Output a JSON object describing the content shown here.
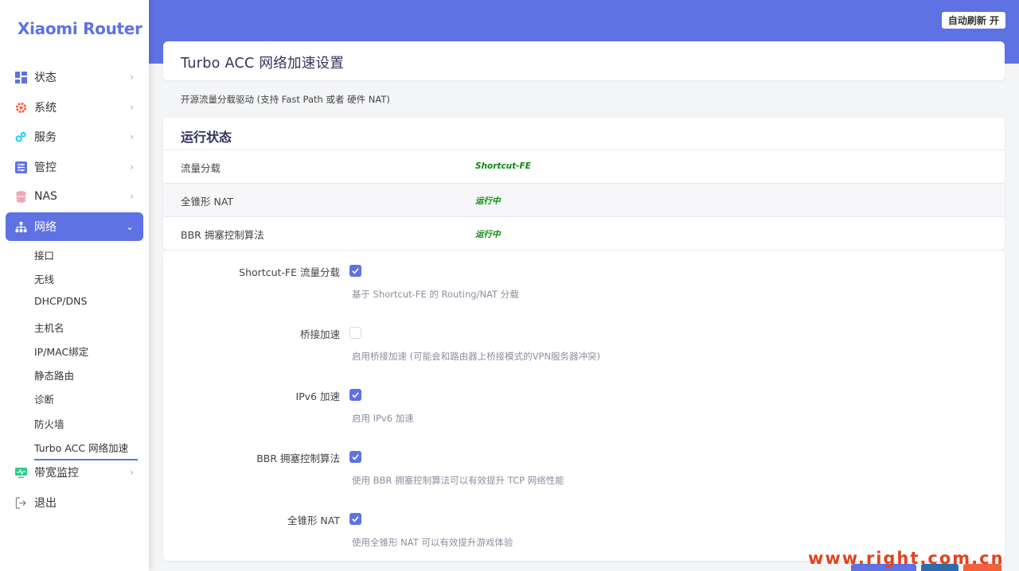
{
  "brand": "Xiaomi Router",
  "header": {
    "refresh_label": "自动刷新 开"
  },
  "sidebar": {
    "items": [
      {
        "label": "状态",
        "icon": "dashboard-icon"
      },
      {
        "label": "系统",
        "icon": "gear-icon"
      },
      {
        "label": "服务",
        "icon": "services-icon"
      },
      {
        "label": "管控",
        "icon": "sliders-icon"
      },
      {
        "label": "NAS",
        "icon": "database-icon"
      },
      {
        "label": "网络",
        "icon": "network-icon"
      },
      {
        "label": "带宽监控",
        "icon": "monitor-icon"
      },
      {
        "label": "退出",
        "icon": "logout-icon"
      }
    ],
    "network_sub": [
      "接口",
      "无线",
      "DHCP/DNS",
      "主机名",
      "IP/MAC绑定",
      "静态路由",
      "诊断",
      "防火墙",
      "Turbo ACC 网络加速"
    ]
  },
  "page": {
    "title": "Turbo ACC 网络加速设置",
    "description": "开源流量分载驱动 (支持 Fast Path 或者 硬件 NAT)"
  },
  "status": {
    "heading": "运行状态",
    "rows": [
      {
        "label": "流量分载",
        "value": "Shortcut-FE"
      },
      {
        "label": "全锥形 NAT",
        "value": "运行中"
      },
      {
        "label": "BBR 拥塞控制算法",
        "value": "运行中"
      }
    ]
  },
  "options": [
    {
      "label": "Shortcut-FE 流量分载",
      "checked": true,
      "help": "基于 Shortcut-FE 的 Routing/NAT 分载"
    },
    {
      "label": "桥接加速",
      "checked": false,
      "help": "启用桥接加速 (可能会和路由器上桥接模式的VPN服务器冲突)"
    },
    {
      "label": "IPv6 加速",
      "checked": true,
      "help": "启用 IPv6 加速"
    },
    {
      "label": "BBR 拥塞控制算法",
      "checked": true,
      "help": "使用 BBR 拥塞控制算法可以有效提升 TCP 网络性能"
    },
    {
      "label": "全锥形 NAT",
      "checked": true,
      "help": "使用全锥形 NAT 可以有效提升游戏体验"
    }
  ],
  "watermark": "www.right.com.cn",
  "colors": {
    "accent": "#5e72e4",
    "ok": "#0b8a0b"
  }
}
